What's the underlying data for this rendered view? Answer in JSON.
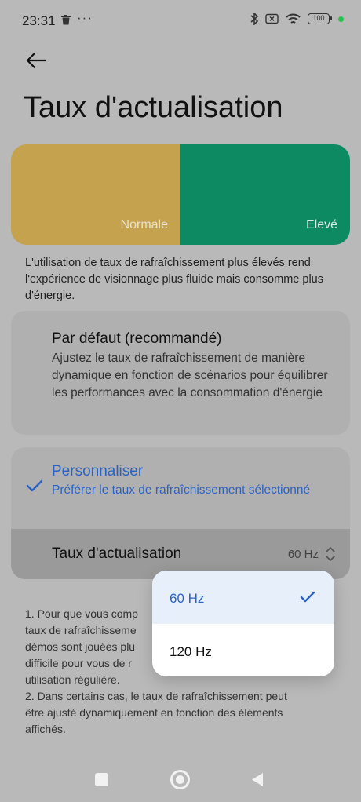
{
  "status_bar": {
    "time": "23:31",
    "dots": "···",
    "battery": "100",
    "icons": [
      "trash-icon",
      "bluetooth-icon",
      "sim-off-icon",
      "wifi-icon",
      "battery-icon"
    ]
  },
  "header": {
    "back_icon": "arrow-left-icon",
    "title": "Taux d'actualisation"
  },
  "preview": {
    "normal_label": "Normale",
    "high_label": "Elevé",
    "normal_color": "#c4a24e",
    "high_color": "#0e8a63"
  },
  "description": "L'utilisation de taux de rafraîchissement plus élevés rend l'expérience de visionnage plus fluide mais consomme plus d'énergie.",
  "options": {
    "default": {
      "title": "Par défaut (recommandé)",
      "subtitle": "Ajustez le taux de rafraîchissement de manière dynamique en fonction de scénarios pour équilibrer les performances avec la consommation d'énergie"
    },
    "custom": {
      "title": "Personnaliser",
      "subtitle": "Préférer le taux de rafraîchissement sélectionné",
      "selected": true
    }
  },
  "rate_row": {
    "label": "Taux d'actualisation",
    "value": "60 Hz"
  },
  "notes": "1. Pour que vous comp… taux de rafraîchisseme… démos sont jouées plu… difficile pour vous de r… utilisation régulière.",
  "notes_lines": [
    "1. Pour que vous comp",
    "taux de rafraîchisseme",
    "démos sont jouées plu",
    "difficile pour vous de r",
    "utilisation régulière.",
    "2. Dans certains cas, le taux de rafraîchissement peut",
    "être ajusté dynamiquement en fonction des éléments",
    "affichés."
  ],
  "dropdown": {
    "options": [
      {
        "label": "60 Hz",
        "selected": true
      },
      {
        "label": "120 Hz",
        "selected": false
      }
    ]
  },
  "colors": {
    "accent": "#2a63c4",
    "scrim": "#b9b9b9"
  }
}
